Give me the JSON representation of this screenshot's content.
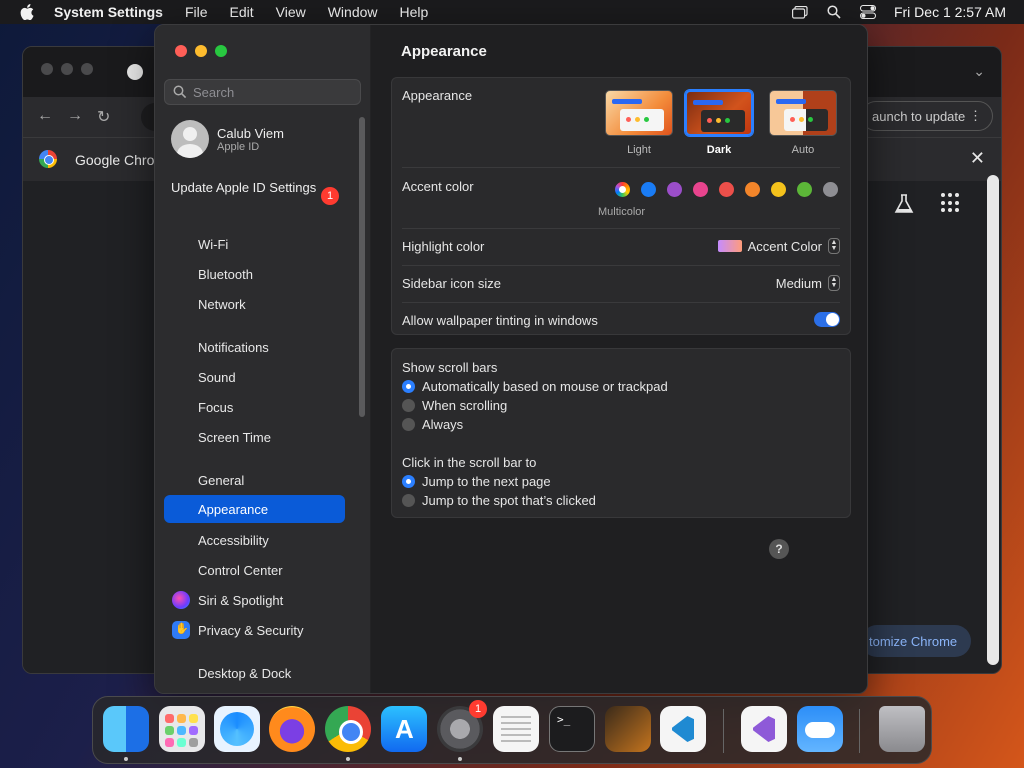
{
  "menubar": {
    "app_name": "System Settings",
    "items": [
      "File",
      "Edit",
      "View",
      "Window",
      "Help"
    ],
    "clock": "Fri Dec 1  2:57 AM"
  },
  "chrome_window": {
    "infobar_label": "Google Chrome",
    "relaunch_label": "aunch to update",
    "customize_label": "tomize Chrome"
  },
  "settings": {
    "search_placeholder": "Search",
    "user": {
      "name": "Calub Viem",
      "subtitle": "Apple ID"
    },
    "update": {
      "label": "Update Apple ID Settings",
      "badge": "1"
    },
    "sidebar": {
      "group1": [
        "Wi-Fi",
        "Bluetooth",
        "Network"
      ],
      "group2": [
        "Notifications",
        "Sound",
        "Focus",
        "Screen Time"
      ],
      "group3": [
        "General",
        "Appearance",
        "Accessibility",
        "Control Center",
        "Siri & Spotlight",
        "Privacy & Security"
      ],
      "group4": [
        "Desktop & Dock"
      ],
      "selected": "Appearance"
    },
    "content": {
      "title": "Appearance",
      "appearance": {
        "label": "Appearance",
        "options": [
          "Light",
          "Dark",
          "Auto"
        ],
        "selected": "Dark"
      },
      "accent": {
        "label": "Accent color",
        "multicolor_label": "Multicolor",
        "colors": [
          "#1a7cf5",
          "#9b4ec9",
          "#e8448e",
          "#ec4f4a",
          "#f3852a",
          "#f4c21c",
          "#5cb638",
          "#8e8e93"
        ]
      },
      "highlight": {
        "label": "Highlight color",
        "value": "Accent Color"
      },
      "sidebar_icon": {
        "label": "Sidebar icon size",
        "value": "Medium"
      },
      "wallpaper_tint": {
        "label": "Allow wallpaper tinting in windows",
        "enabled": true
      },
      "scroll_bars": {
        "label": "Show scroll bars",
        "options": [
          "Automatically based on mouse or trackpad",
          "When scrolling",
          "Always"
        ],
        "selected": "Automatically based on mouse or trackpad"
      },
      "click_scroll": {
        "label": "Click in the scroll bar to",
        "options": [
          "Jump to the next page",
          "Jump to the spot that’s clicked"
        ],
        "selected": "Jump to the next page"
      },
      "help": "?"
    }
  },
  "dock": {
    "apps": [
      "Finder",
      "Launchpad",
      "Safari",
      "Firefox",
      "Google Chrome",
      "App Store",
      "System Settings",
      "TextEdit",
      "Terminal",
      "GarageBand",
      "Visual Studio Code",
      "Visual Studio",
      "Weather",
      "Trash"
    ],
    "settings_badge": "1"
  }
}
